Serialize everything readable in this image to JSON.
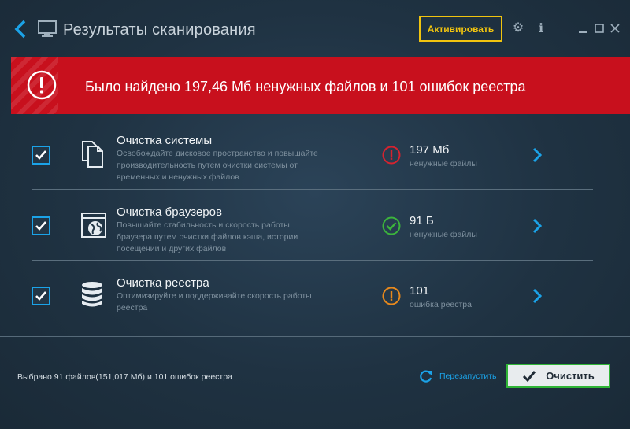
{
  "header": {
    "title": "Результаты сканирования",
    "activate_label": "Активировать",
    "settings_icon": "gear-icon",
    "info_label": "i"
  },
  "banner": {
    "message": "Было найдено 197,46 Мб ненужных файлов и 101 ошибок реестра",
    "color": "#c8101d"
  },
  "items": [
    {
      "title": "Очистка системы",
      "description": "Освобождайте дисковое пространство и повышайте производительность путем очистки системы от временных и ненужных файлов",
      "value": "197 Мб",
      "value_label": "ненужные файлы",
      "status": "error",
      "status_color": "#d6232f",
      "checked": true
    },
    {
      "title": "Очистка браузеров",
      "description": "Повышайте стабильность и скорость работы браузера путем очистки файлов кэша, истории посещении и других файлов",
      "value": "91 Б",
      "value_label": "ненужные файлы",
      "status": "ok",
      "status_color": "#3cb43c",
      "checked": true
    },
    {
      "title": "Очистка реестра",
      "description": "Оптимизируйте и поддерживайте скорость работы реестра",
      "value": "101",
      "value_label": "ошибка реестра",
      "status": "warning",
      "status_color": "#e8891c",
      "checked": true
    }
  ],
  "footer": {
    "summary": "Выбрано 91 файлов(151,017 Мб) и 101 ошибок реестра",
    "restart_label": "Перезапустить",
    "clean_label": "Очистить"
  },
  "colors": {
    "accent": "#1ba3e8",
    "activate": "#f1c40f",
    "clean_border": "#2fb536"
  }
}
